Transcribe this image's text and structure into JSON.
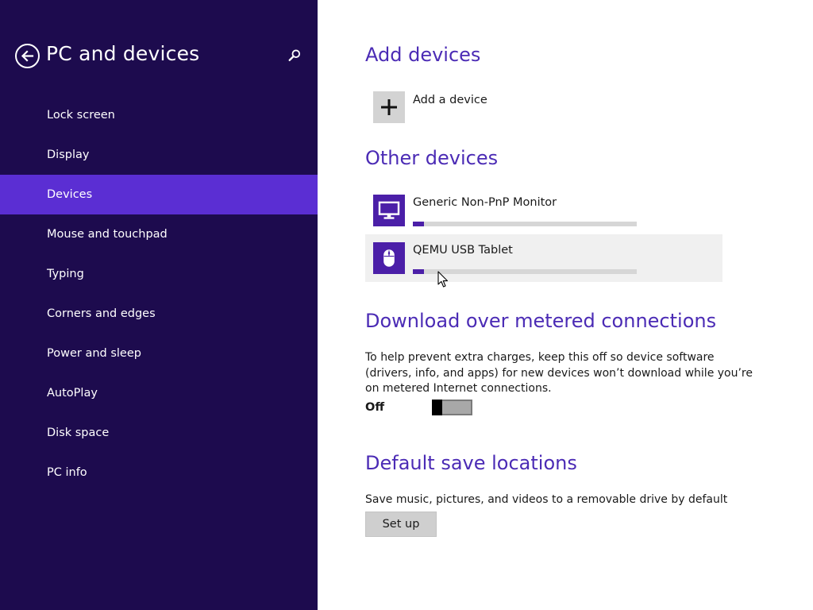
{
  "sidebar": {
    "title": "PC and devices",
    "items": [
      {
        "label": "Lock screen",
        "selected": false
      },
      {
        "label": "Display",
        "selected": false
      },
      {
        "label": "Devices",
        "selected": true
      },
      {
        "label": "Mouse and touchpad",
        "selected": false
      },
      {
        "label": "Typing",
        "selected": false
      },
      {
        "label": "Corners and edges",
        "selected": false
      },
      {
        "label": "Power and sleep",
        "selected": false
      },
      {
        "label": "AutoPlay",
        "selected": false
      },
      {
        "label": "Disk space",
        "selected": false
      },
      {
        "label": "PC info",
        "selected": false
      }
    ]
  },
  "add_devices": {
    "heading": "Add devices",
    "add_label": "Add a device"
  },
  "other_devices": {
    "heading": "Other devices",
    "devices": [
      {
        "name": "Generic Non-PnP Monitor",
        "icon": "monitor-icon",
        "progress": 0.05
      },
      {
        "name": "QEMU USB Tablet",
        "icon": "mouse-icon",
        "progress": 0.05
      }
    ]
  },
  "metered": {
    "heading": "Download over metered connections",
    "description": "To help prevent extra charges, keep this off so device software (drivers, info, and apps) for new devices won’t download while you’re on metered Internet connections.",
    "toggle_label": "Off",
    "toggle_on": false
  },
  "save_locations": {
    "heading": "Default save locations",
    "description": "Save music, pictures, and videos to a removable drive by default",
    "button_label": "Set up"
  },
  "colors": {
    "sidebar_bg": "#1d0b4e",
    "selected_bg": "#5b2ed3",
    "accent": "#4b2bb5",
    "device_icon_bg": "#4b1fa8"
  }
}
